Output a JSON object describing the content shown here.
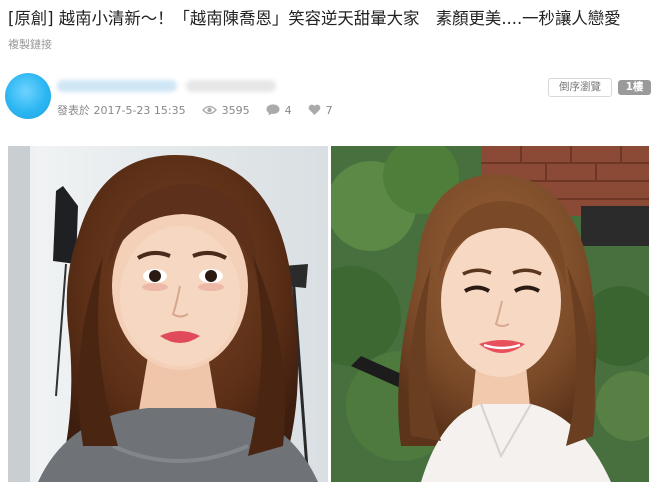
{
  "post": {
    "title": "[原創] 越南小清新～！「越南陳喬恩」笑容逆天甜暈大家　素顏更美....一秒讓人戀愛",
    "copy_link": "複製鏈接"
  },
  "author": {
    "avatar_icon": "avatar-image",
    "posted_at": "發表於 2017-5-23 15:35",
    "views": "3595",
    "replies": "4",
    "likes": "7",
    "view_icon": "eye-icon",
    "reply_icon": "comment-icon",
    "like_icon": "heart-icon"
  },
  "toolbar": {
    "reverse_label": "倒序瀏覽",
    "floor_label": "1樓"
  },
  "images": [
    {
      "icon": "portrait-photo"
    },
    {
      "icon": "portrait-photo"
    }
  ],
  "colors": {
    "avatar": "#2bb6f2",
    "badge": "#9a9a9a",
    "text_meta": "#888888"
  }
}
